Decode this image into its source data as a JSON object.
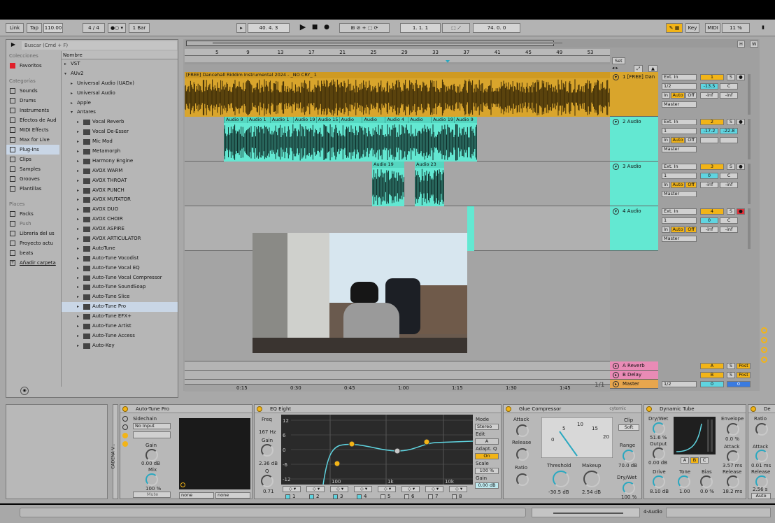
{
  "transport": {
    "link": "Link",
    "tap": "Tap",
    "tempo": "110.00",
    "signature": "4 / 4",
    "metro": "1 Bar",
    "position": "40.  4.  3",
    "loop_start": "1.  1.  1",
    "loop_length": "74.  0.  0",
    "key": "Key",
    "midi": "MIDI",
    "cpu": "11 %"
  },
  "browser": {
    "search_placeholder": "Buscar (Cmd + F)",
    "collections_header": "Colecciones",
    "favorites": "Favoritos",
    "categories_header": "Categorías",
    "categories": [
      "Sounds",
      "Drums",
      "Instruments",
      "Efectos de Aud",
      "MIDI Effects",
      "Max for Live",
      "Plug-Ins",
      "Clips",
      "Samples",
      "Grooves",
      "Plantillas"
    ],
    "places_header": "Places",
    "places": [
      "Packs",
      "Push",
      "Libreria del us",
      "Proyecto actu",
      "beats",
      "Añadir carpeta"
    ],
    "tree_header": "Nombre",
    "tree": [
      {
        "label": "VST",
        "indent": 0,
        "type": "folder"
      },
      {
        "label": "AUv2",
        "indent": 0,
        "type": "folder-open"
      },
      {
        "label": "Universal Audio (UADx)",
        "indent": 1,
        "type": "folder"
      },
      {
        "label": "Universal Audio",
        "indent": 1,
        "type": "folder"
      },
      {
        "label": "Apple",
        "indent": 1,
        "type": "folder"
      },
      {
        "label": "Antares",
        "indent": 1,
        "type": "folder-open"
      },
      {
        "label": "Vocal Reverb",
        "indent": 2,
        "type": "plugin"
      },
      {
        "label": "Vocal De-Esser",
        "indent": 2,
        "type": "plugin"
      },
      {
        "label": "Mic Mod",
        "indent": 2,
        "type": "plugin"
      },
      {
        "label": "Metamorph",
        "indent": 2,
        "type": "plugin"
      },
      {
        "label": "Harmony Engine",
        "indent": 2,
        "type": "plugin"
      },
      {
        "label": "AVOX WARM",
        "indent": 2,
        "type": "plugin"
      },
      {
        "label": "AVOX THROAT",
        "indent": 2,
        "type": "plugin"
      },
      {
        "label": "AVOX PUNCH",
        "indent": 2,
        "type": "plugin"
      },
      {
        "label": "AVOX MUTATOR",
        "indent": 2,
        "type": "plugin"
      },
      {
        "label": "AVOX DUO",
        "indent": 2,
        "type": "plugin"
      },
      {
        "label": "AVOX CHOIR",
        "indent": 2,
        "type": "plugin"
      },
      {
        "label": "AVOX ASPIRE",
        "indent": 2,
        "type": "plugin"
      },
      {
        "label": "AVOX ARTICULATOR",
        "indent": 2,
        "type": "plugin"
      },
      {
        "label": "AutoTune",
        "indent": 2,
        "type": "plugin"
      },
      {
        "label": "Auto-Tune Vocodist",
        "indent": 2,
        "type": "plugin"
      },
      {
        "label": "Auto-Tune Vocal EQ",
        "indent": 2,
        "type": "plugin"
      },
      {
        "label": "Auto-Tune Vocal Compressor",
        "indent": 2,
        "type": "plugin"
      },
      {
        "label": "Auto-Tune SoundSoap",
        "indent": 2,
        "type": "plugin"
      },
      {
        "label": "Auto-Tune Slice",
        "indent": 2,
        "type": "plugin"
      },
      {
        "label": "Auto-Tune Pro",
        "indent": 2,
        "type": "plugin",
        "selected": true
      },
      {
        "label": "Auto-Tune EFX+",
        "indent": 2,
        "type": "plugin"
      },
      {
        "label": "Auto-Tune Artist",
        "indent": 2,
        "type": "plugin"
      },
      {
        "label": "Auto-Tune Access",
        "indent": 2,
        "type": "plugin"
      },
      {
        "label": "Auto-Key",
        "indent": 2,
        "type": "plugin"
      }
    ]
  },
  "ruler": [
    "5",
    "9",
    "13",
    "17",
    "21",
    "25",
    "29",
    "33",
    "37",
    "41",
    "45",
    "49",
    "53"
  ],
  "timeline": [
    "0:15",
    "0:30",
    "0:45",
    "1:00",
    "1:15",
    "1:30",
    "1:45"
  ],
  "set_label": "Set",
  "zoom": "1/1",
  "tracks": [
    {
      "num": "1",
      "name": "1 [FREE] Dan",
      "input": "Ext. In",
      "channel": "1/2",
      "monitor": [
        "In",
        "Auto",
        "Off"
      ],
      "output": "Master",
      "vol": "-13.5",
      "pan": "C",
      "sends": [
        "-inf",
        "-inf"
      ],
      "color": "#d9a52c"
    },
    {
      "num": "2",
      "name": "2 Audio",
      "input": "Ext. In",
      "channel": "1",
      "monitor": [
        "In",
        "Auto",
        "Off"
      ],
      "output": "Master",
      "vol": "-17.2",
      "pan": "-22.8",
      "sends": [
        "",
        ""
      ],
      "color": "#63e8d2"
    },
    {
      "num": "3",
      "name": "3 Audio",
      "input": "Ext. In",
      "channel": "1",
      "monitor": [
        "In",
        "Auto",
        "Off"
      ],
      "output": "Master",
      "vol": "0",
      "pan": "C",
      "sends": [
        "-inf",
        "-inf"
      ],
      "color": "#63e8d2"
    },
    {
      "num": "4",
      "name": "4 Audio",
      "input": "Ext. In",
      "channel": "1",
      "monitor": [
        "In",
        "Auto",
        "Off"
      ],
      "output": "Master",
      "vol": "0",
      "pan": "C",
      "sends": [
        "-inf",
        "-inf"
      ],
      "color": "#63e8d2"
    }
  ],
  "clip1_title": "[FREE] Dancehall Riddim Instrumental 2024 - _NO CRY_ 1",
  "clips2": [
    "Audio 9",
    "Audio 1",
    "Audio 1",
    "Audio 19",
    "Audio 15",
    "Audio",
    "Audio",
    "Audio 4",
    "Audio",
    "Audio 19",
    "Audio 9"
  ],
  "clips3": [
    "Audio 19",
    "Audio 23"
  ],
  "returns": [
    {
      "letter": "A",
      "name": "A Reverb",
      "color": "#e98bb6"
    },
    {
      "letter": "B",
      "name": "B Delay",
      "color": "#e98bb6"
    },
    {
      "letter": "",
      "name": "Master",
      "color": "#e7a64e",
      "channel": "1/2",
      "vol": "0",
      "pan": "0"
    }
  ],
  "return_post": "Post",
  "devices": {
    "rack_label": "CADENA V...",
    "autotune": {
      "title": "Auto-Tune Pro",
      "sidechain": "Sidechain",
      "input": "No Input",
      "gain": "Gain",
      "gain_val": "0.00 dB",
      "mix": "Mix",
      "mix_val": "100 %",
      "mute": "Mute",
      "sel1": "none",
      "sel2": "none"
    },
    "eq": {
      "title": "EQ Eight",
      "freq": "Freq",
      "freq_val": "167 Hz",
      "gain": "Gain",
      "gain_val": "2.36 dB",
      "q": "Q",
      "q_val": "0.71",
      "mode": "Mode",
      "mode_val": "Stereo",
      "edit": "Edit",
      "edit_val": "A",
      "adapt": "Adapt. Q",
      "adapt_val": "On",
      "scale": "Scale",
      "scale_val": "100 %",
      "gain2": "Gain",
      "gain2_val": "0.00 dB",
      "yticks": [
        "12",
        "6",
        "0",
        "-6",
        "-12"
      ],
      "xticks": [
        "100",
        "1k",
        "10k"
      ],
      "bands": [
        "1",
        "2",
        "3",
        "4",
        "5",
        "6",
        "7",
        "8"
      ]
    },
    "glue": {
      "title": "Glue Compressor",
      "brand": "cytomic",
      "attack": "Attack",
      "release": "Release",
      "ratio": "Ratio",
      "threshold": "Threshold",
      "threshold_val": "-30.5 dB",
      "makeup": "Makeup",
      "makeup_val": "2.54 dB",
      "clip": "Clip",
      "clip_val": "Soft",
      "range": "Range",
      "range_val": "70.0 dB",
      "drywet": "Dry/Wet",
      "drywet_val": "100 %",
      "meter_ticks": [
        "0",
        "5",
        "10",
        "15",
        "20"
      ]
    },
    "tube": {
      "title": "Dynamic Tube",
      "drywet": "Dry/Wet",
      "drywet_val": "51.6 %",
      "output": "Output",
      "output_val": "0.00 dB",
      "drive": "Drive",
      "drive_val": "8.10 dB",
      "tone": "Tone",
      "tone_val": "1.00",
      "bias": "Bias",
      "bias_val": "0.0 %",
      "envelope": "Envelope",
      "envelope_val": "0.0 %",
      "attack": "Attack",
      "attack_val": "3.57 ms",
      "release": "Release",
      "release_val": "18.2 ms",
      "abc": [
        "A",
        "B",
        "C"
      ]
    },
    "extra": {
      "title": "De",
      "ratio": "Ratio",
      "attack": "Attack",
      "attack_val": "0.01 ms",
      "release": "Release",
      "release_val": "2.56 s",
      "auto": "Auto"
    }
  },
  "status": {
    "track": "4-Audio"
  }
}
